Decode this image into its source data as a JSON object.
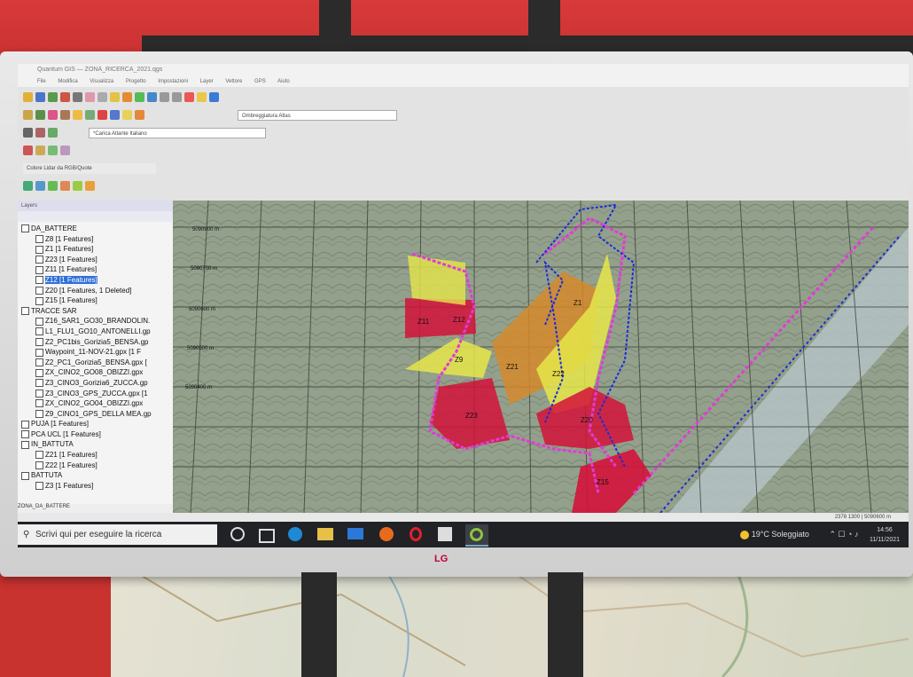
{
  "app": {
    "title": "Quantum GIS — ZONA_RICERCA_2021.qgs",
    "menu": [
      "File",
      "Modifica",
      "Visualizza",
      "Progetto",
      "Impostazioni",
      "Layer",
      "Vettore",
      "GPS",
      "Aiuto"
    ]
  },
  "toolbar": {
    "loader_combo": "*Carica Atlante Italiano",
    "style_combo": "Ombreggiatura Atlas",
    "lidar_combo": "Colore Lidar da RGB/Quote"
  },
  "layers_panel": {
    "header": "Layers",
    "items": [
      {
        "label": "DA_BATTERE",
        "level": 0,
        "selected": false
      },
      {
        "label": "Z8 [1 Features]",
        "level": 1,
        "selected": false
      },
      {
        "label": "Z1 [1 Features]",
        "level": 1,
        "selected": false
      },
      {
        "label": "Z23 [1 Features]",
        "level": 1,
        "selected": false
      },
      {
        "label": "Z11 [1 Features]",
        "level": 1,
        "selected": false
      },
      {
        "label": "Z12 [1 Features]",
        "level": 1,
        "selected": true
      },
      {
        "label": "Z20 [1 Features, 1 Deleted]",
        "level": 1,
        "selected": false
      },
      {
        "label": "Z15 [1 Features]",
        "level": 1,
        "selected": false
      },
      {
        "label": "TRACCE SAR",
        "level": 0,
        "selected": false
      },
      {
        "label": "Z16_SAR1_GO30_BRANDOLIN.",
        "level": 1,
        "selected": false
      },
      {
        "label": "L1_FLU1_GO10_ANTONELLI.gp",
        "level": 1,
        "selected": false
      },
      {
        "label": "Z2_PC1bis_Gorizia5_BENSA.gp",
        "level": 1,
        "selected": false
      },
      {
        "label": "Waypoint_11-NOV-21.gpx [1 F",
        "level": 1,
        "selected": false
      },
      {
        "label": "Z2_PC1_Gorizia5_BENSA.gpx [",
        "level": 1,
        "selected": false
      },
      {
        "label": "ZX_CINO2_GO08_OBIZZI.gpx",
        "level": 1,
        "selected": false
      },
      {
        "label": "Z3_CINO3_Gorizia6_ZUCCA.gp",
        "level": 1,
        "selected": false
      },
      {
        "label": "Z3_CINO3_GPS_ZUCCA.gpx [1",
        "level": 1,
        "selected": false
      },
      {
        "label": "ZX_CINO2_GO04_OBIZZI.gpx",
        "level": 1,
        "selected": false
      },
      {
        "label": "Z9_CINO1_GPS_DELLA MEA.gp",
        "level": 1,
        "selected": false
      },
      {
        "label": "PUJA [1 Features]",
        "level": 0,
        "selected": false
      },
      {
        "label": "PCA UCL [1 Features]",
        "level": 0,
        "selected": false
      },
      {
        "label": "IN_BATTUTA",
        "level": 0,
        "selected": false
      },
      {
        "label": "Z21 [1 Features]",
        "level": 1,
        "selected": false
      },
      {
        "label": "Z22 [1 Features]",
        "level": 1,
        "selected": false
      },
      {
        "label": "BATTUTA",
        "level": 0,
        "selected": false
      },
      {
        "label": "Z3 [1 Features]",
        "level": 1,
        "selected": false
      }
    ],
    "footer": "ZONA_DA_BATTERE"
  },
  "map": {
    "grid_labels": [
      "5090900 m",
      "5090700 m",
      "5090600 m",
      "5090500 m",
      "5090400 m"
    ],
    "zone_labels": [
      "Z11",
      "Z12",
      "Z9",
      "Z21",
      "Z23",
      "Z1",
      "Z22",
      "Z20",
      "Z15"
    ],
    "colors": {
      "zone_red": "#d4123a",
      "zone_yellow": "#e6e64a",
      "zone_orange": "#d58a2a",
      "track_magenta": "#e23ad8",
      "track_blue": "#1b2bd9"
    }
  },
  "statusbar": {
    "coords": "2378 1300 | 5090600 m"
  },
  "taskbar": {
    "search_placeholder": "Scrivi qui per eseguire la ricerca",
    "weather": "19°C Soleggiato",
    "time": "14:56",
    "date": "11/11/2021",
    "apps": [
      "start",
      "task-view",
      "edge",
      "file-explorer",
      "mail",
      "firefox",
      "opera",
      "store",
      "qgis"
    ]
  },
  "monitor": {
    "brand": "LG"
  }
}
